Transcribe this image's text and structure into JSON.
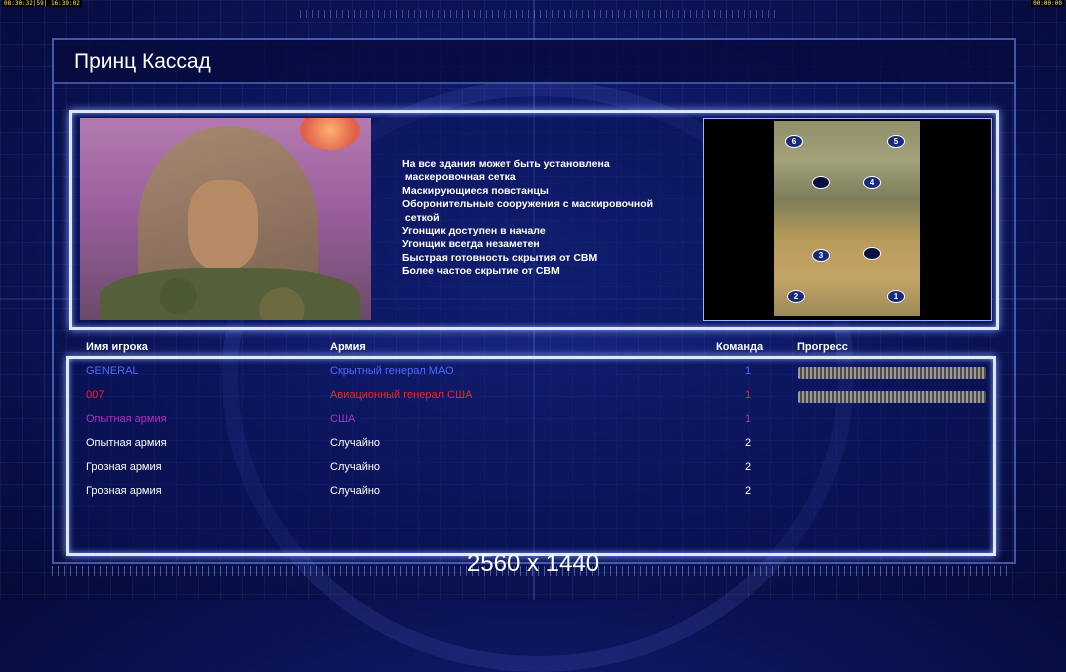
{
  "clock": {
    "left": "08:30:32|59| 16:39:02",
    "right": "00:00:00"
  },
  "title": "Принц Кассад",
  "features": [
    "На все здания может быть установлена",
    " маскеровочная сетка",
    "Маскирующиеся повстанцы",
    "Оборонительные сооружения с маскировочной",
    " сеткой",
    "Угонщик доступен в начале",
    "Угонщик всегда незаметен",
    "Быстрая готовность скрытия от СВМ",
    "Более частое скрытие от СВМ"
  ],
  "minimap": {
    "spots": [
      "6",
      "5",
      "",
      "4",
      "3",
      "",
      "2",
      "1"
    ]
  },
  "table": {
    "headers": {
      "name": "Имя игрока",
      "army": "Армия",
      "team": "Команда",
      "progress": "Прогресс"
    },
    "rows": [
      {
        "name": "GENERAL",
        "army": "Скрытный генерал МАО",
        "team": "1",
        "color": "#4a6cff",
        "progress": true
      },
      {
        "name": "007",
        "army": "Авиационный генерал США",
        "team": "1",
        "color": "#ff2020",
        "progress": true
      },
      {
        "name": "Опытная армия",
        "army": "США",
        "team": "1",
        "color": "#b030c0",
        "progress": false
      },
      {
        "name": "Опытная армия",
        "army": "Случайно",
        "team": "2",
        "color": "#ffffff",
        "progress": false
      },
      {
        "name": "Грозная армия",
        "army": "Случайно",
        "team": "2",
        "color": "#ffffff",
        "progress": false
      },
      {
        "name": "Грозная армия",
        "army": "Случайно",
        "team": "2",
        "color": "#ffffff",
        "progress": false
      }
    ]
  },
  "resolution": "2560 x 1440"
}
